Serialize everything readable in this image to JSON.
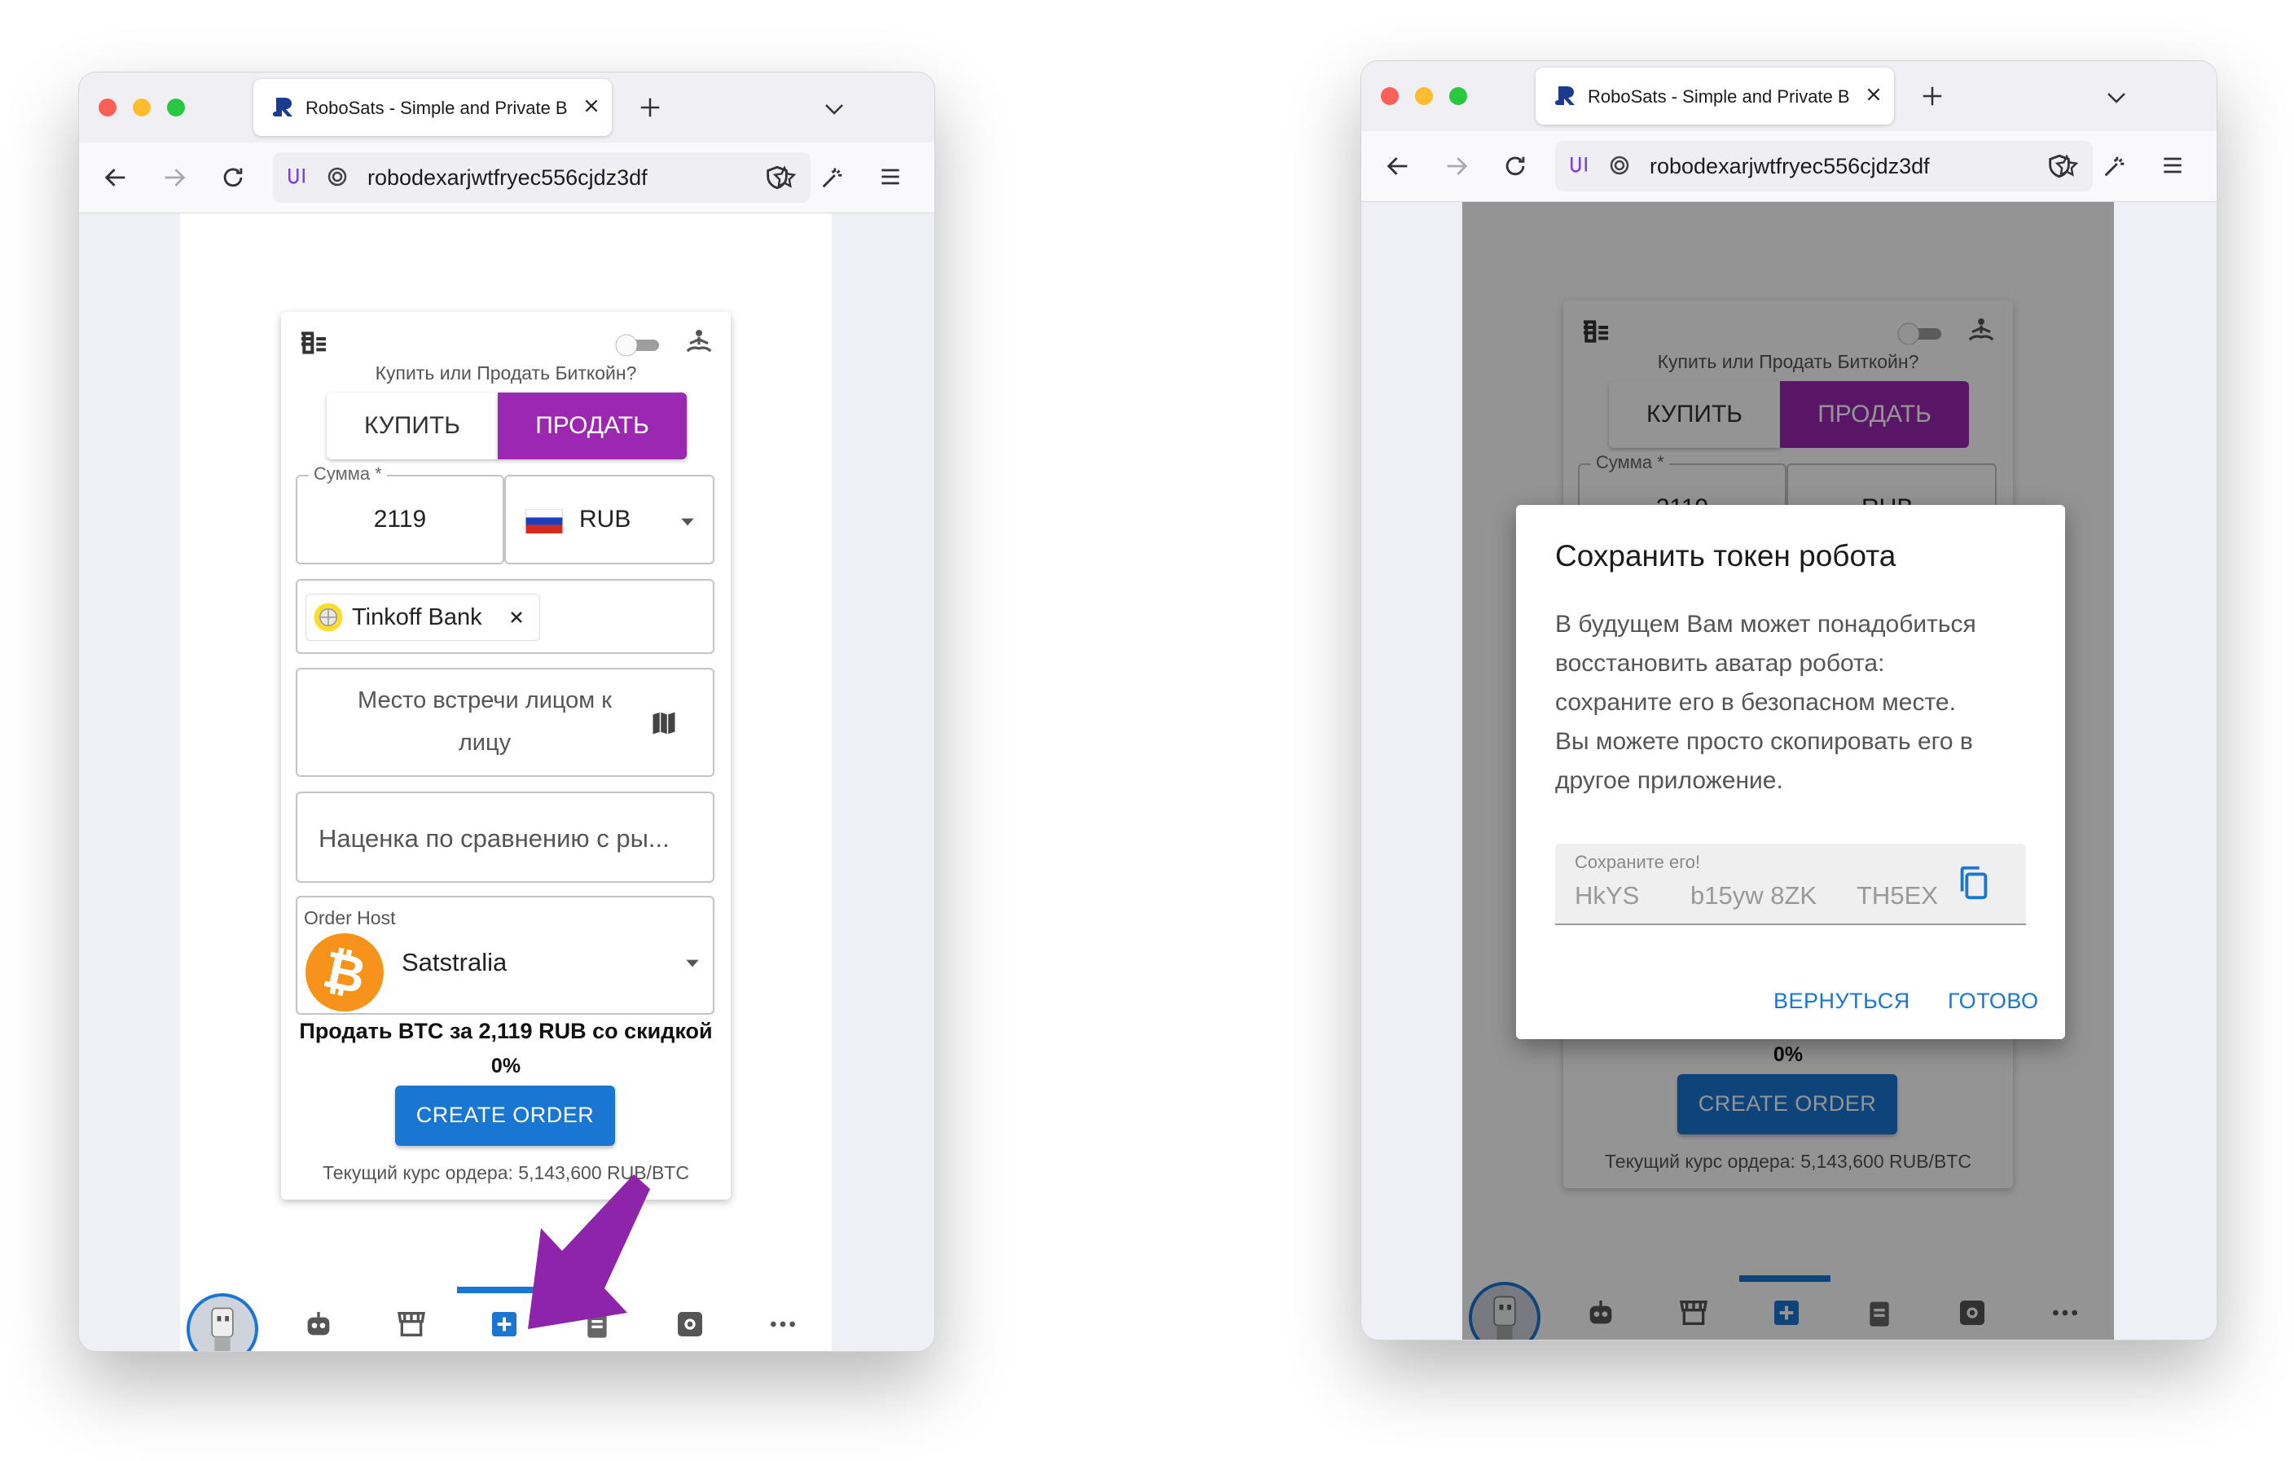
{
  "browser": {
    "tab_title": "RoboSats - Simple and Private B",
    "url": "robodexarjwtfryec556cjdz3df"
  },
  "order_form": {
    "question": "Купить или Продать Биткойн?",
    "buy_label": "КУПИТЬ",
    "sell_label": "ПРОДАТЬ",
    "amount_label": "Сумма *",
    "amount_value": "2119",
    "currency": "RUB",
    "payment_method_chip": "Tinkoff Bank",
    "meetup_placeholder_line1": "Место встречи лицом к",
    "meetup_placeholder_line2": "лицу",
    "premium_placeholder": "Наценка по сравнению с ры...",
    "order_host_label": "Order Host",
    "order_host_value": "Satstralia",
    "summary_line1": "Продать BTC за 2,119 RUB со скидкой",
    "summary_line2": "0%",
    "create_order_label": "CREATE ORDER",
    "rate_text": "Текущий курс ордера: 5,143,600 RUB/BTC"
  },
  "dialog": {
    "title": "Сохранить токен робота",
    "body_lines": [
      "В будущем Вам может понадобиться",
      "восстановить аватар робота:",
      "сохраните его в безопасном месте.",
      "Вы можете просто скопировать его в",
      "другое приложение."
    ],
    "token_label": "Сохраните его!",
    "token_parts": [
      "HkYS",
      "b15yw 8ZK",
      "TH5EX"
    ],
    "back_label": "ВЕРНУТЬСЯ",
    "done_label": "ГОТОВО"
  },
  "partial_behind_dialog": {
    "amount_value": "2119",
    "currency": "RUB"
  },
  "colors": {
    "primary": "#1976d2",
    "sell_purple": "#9c27b0",
    "arrow_purple": "#8e24aa",
    "host_orange": "#f7931a"
  },
  "icons": [
    "trash-list-icon",
    "toggle-icon",
    "meditation-icon",
    "russia-flag-icon",
    "dropdown-icon",
    "bank-logo-icon",
    "map-icon",
    "bitcoin-logo-icon",
    "copy-icon",
    "robot-avatar-icon",
    "robot-icon",
    "store-icon",
    "add-box-icon",
    "clipboard-icon",
    "settings-icon",
    "more-icon"
  ]
}
